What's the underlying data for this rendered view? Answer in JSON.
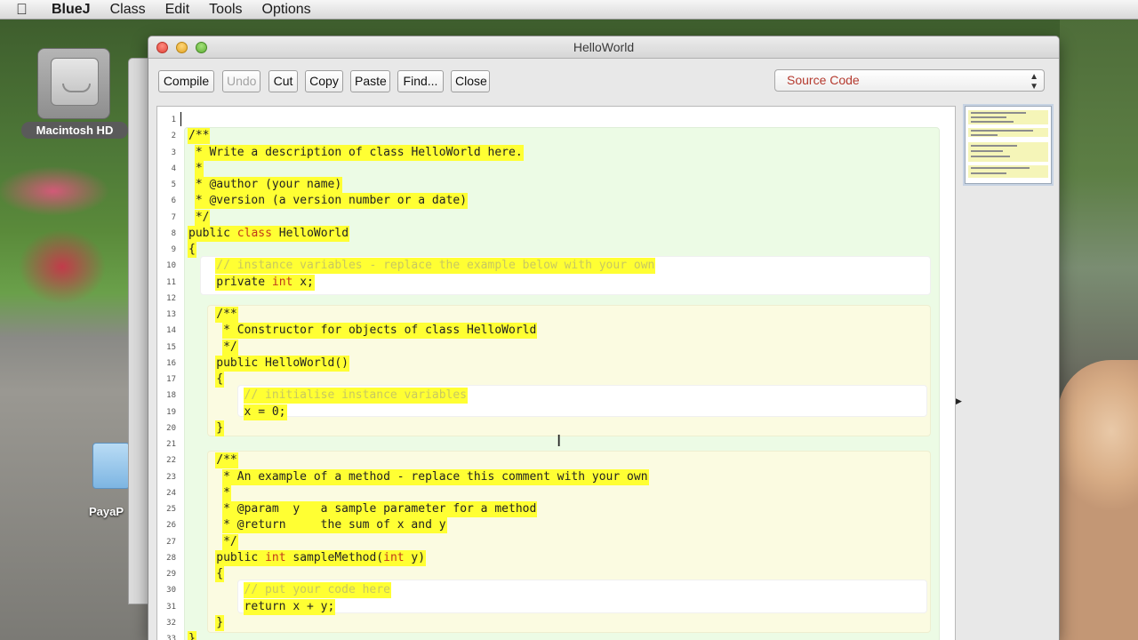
{
  "menubar": {
    "app_name": "BlueJ",
    "menus": [
      "Class",
      "Edit",
      "Tools",
      "Options"
    ]
  },
  "desktop": {
    "drive_label": "Macintosh HD",
    "folder_label": "PayaP"
  },
  "window": {
    "title": "HelloWorld"
  },
  "toolbar": {
    "buttons": [
      {
        "label": "Compile",
        "enabled": true
      },
      {
        "label": "Undo",
        "enabled": false
      },
      {
        "label": "Cut",
        "enabled": true
      },
      {
        "label": "Copy",
        "enabled": true
      },
      {
        "label": "Paste",
        "enabled": true
      },
      {
        "label": "Find...",
        "enabled": true
      },
      {
        "label": "Close",
        "enabled": true
      }
    ],
    "view_select": "Source Code"
  },
  "colors": {
    "highlight": "#ffff33",
    "keyword": "#c0391b",
    "comment": "#c8c860",
    "class_scope": "#ecfbe5",
    "method_scope": "#fbfbe1"
  },
  "code": {
    "lines": [
      {
        "n": "1",
        "text": ""
      },
      {
        "n": "2",
        "text": "/**"
      },
      {
        "n": "3",
        "text": " * Write a description of class HelloWorld here."
      },
      {
        "n": "4",
        "text": " *"
      },
      {
        "n": "5",
        "text": " * @author (your name)"
      },
      {
        "n": "6",
        "text": " * @version (a version number or a date)"
      },
      {
        "n": "7",
        "text": " */"
      },
      {
        "n": "8",
        "text": "public class HelloWorld"
      },
      {
        "n": "9",
        "text": "{"
      },
      {
        "n": "10",
        "text": "    // instance variables - replace the example below with your own"
      },
      {
        "n": "11",
        "text": "    private int x;"
      },
      {
        "n": "12",
        "text": ""
      },
      {
        "n": "13",
        "text": "    /**"
      },
      {
        "n": "14",
        "text": "     * Constructor for objects of class HelloWorld"
      },
      {
        "n": "15",
        "text": "     */"
      },
      {
        "n": "16",
        "text": "    public HelloWorld()"
      },
      {
        "n": "17",
        "text": "    {"
      },
      {
        "n": "18",
        "text": "        // initialise instance variables"
      },
      {
        "n": "19",
        "text": "        x = 0;"
      },
      {
        "n": "20",
        "text": "    }"
      },
      {
        "n": "21",
        "text": ""
      },
      {
        "n": "22",
        "text": "    /**"
      },
      {
        "n": "23",
        "text": "     * An example of a method - replace this comment with your own"
      },
      {
        "n": "24",
        "text": "     *"
      },
      {
        "n": "25",
        "text": "     * @param  y   a sample parameter for a method"
      },
      {
        "n": "26",
        "text": "     * @return     the sum of x and y"
      },
      {
        "n": "27",
        "text": "     */"
      },
      {
        "n": "28",
        "text": "    public int sampleMethod(int y)"
      },
      {
        "n": "29",
        "text": "    {"
      },
      {
        "n": "30",
        "text": "        // put your code here"
      },
      {
        "n": "31",
        "text": "        return x + y;"
      },
      {
        "n": "32",
        "text": "    }"
      },
      {
        "n": "33",
        "text": "}"
      }
    ]
  }
}
